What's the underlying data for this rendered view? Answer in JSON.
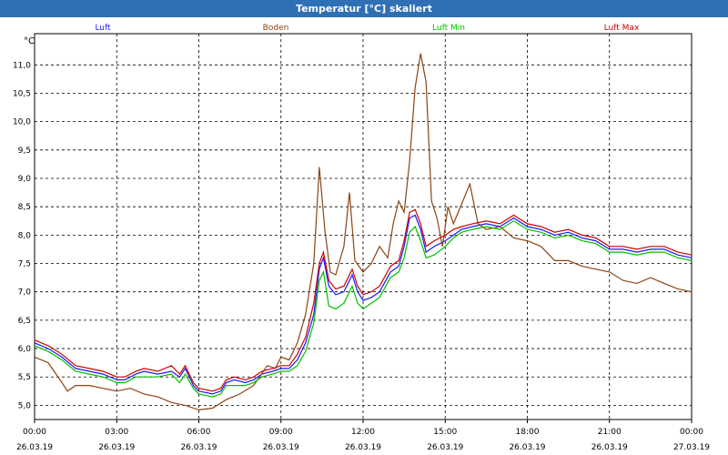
{
  "window": {
    "title": "Temperatur [°C] skaliert"
  },
  "chart_data": {
    "type": "line",
    "title": "Temperatur [°C] skaliert",
    "ylabel": "°C",
    "ylim": [
      4.75,
      11.55
    ],
    "yticks": [
      "5,0",
      "5,5",
      "6,0",
      "6,5",
      "7,0",
      "7,5",
      "8,0",
      "8,5",
      "9,0",
      "9,5",
      "10,0",
      "10,5",
      "11,0"
    ],
    "xlim_hours": [
      0,
      24
    ],
    "xticks": [
      {
        "time": "00:00",
        "date": "26.03.19"
      },
      {
        "time": "03:00",
        "date": "26.03.19"
      },
      {
        "time": "06:00",
        "date": "26.03.19"
      },
      {
        "time": "09:00",
        "date": "26.03.19"
      },
      {
        "time": "12:00",
        "date": "26.03.19"
      },
      {
        "time": "15:00",
        "date": "26.03.19"
      },
      {
        "time": "18:00",
        "date": "26.03.19"
      },
      {
        "time": "21:00",
        "date": "26.03.19"
      },
      {
        "time": "00:00",
        "date": "27.03.19"
      }
    ],
    "grid": true,
    "legend_position": "top",
    "series": [
      {
        "name": "Luft",
        "color": "#1a1aff",
        "points": [
          [
            0,
            6.1
          ],
          [
            0.5,
            6.0
          ],
          [
            1,
            5.85
          ],
          [
            1.5,
            5.65
          ],
          [
            2,
            5.6
          ],
          [
            2.5,
            5.55
          ],
          [
            3,
            5.45
          ],
          [
            3.3,
            5.45
          ],
          [
            3.7,
            5.55
          ],
          [
            4,
            5.6
          ],
          [
            4.5,
            5.55
          ],
          [
            5,
            5.6
          ],
          [
            5.3,
            5.5
          ],
          [
            5.5,
            5.65
          ],
          [
            5.8,
            5.35
          ],
          [
            6,
            5.25
          ],
          [
            6.5,
            5.2
          ],
          [
            6.8,
            5.25
          ],
          [
            7,
            5.4
          ],
          [
            7.3,
            5.45
          ],
          [
            7.7,
            5.4
          ],
          [
            8,
            5.45
          ],
          [
            8.3,
            5.55
          ],
          [
            8.7,
            5.6
          ],
          [
            9,
            5.65
          ],
          [
            9.3,
            5.65
          ],
          [
            9.6,
            5.8
          ],
          [
            9.9,
            6.1
          ],
          [
            10.2,
            6.6
          ],
          [
            10.4,
            7.4
          ],
          [
            10.55,
            7.6
          ],
          [
            10.75,
            7.1
          ],
          [
            11,
            6.95
          ],
          [
            11.3,
            7.0
          ],
          [
            11.6,
            7.3
          ],
          [
            11.8,
            7.0
          ],
          [
            12,
            6.85
          ],
          [
            12.3,
            6.9
          ],
          [
            12.6,
            7.0
          ],
          [
            13,
            7.35
          ],
          [
            13.3,
            7.45
          ],
          [
            13.5,
            7.8
          ],
          [
            13.7,
            8.3
          ],
          [
            13.9,
            8.35
          ],
          [
            14.1,
            8.1
          ],
          [
            14.3,
            7.7
          ],
          [
            14.6,
            7.8
          ],
          [
            15,
            7.9
          ],
          [
            15.3,
            8.0
          ],
          [
            15.6,
            8.1
          ],
          [
            16,
            8.15
          ],
          [
            16.5,
            8.2
          ],
          [
            17,
            8.15
          ],
          [
            17.5,
            8.3
          ],
          [
            18,
            8.15
          ],
          [
            18.5,
            8.1
          ],
          [
            19,
            8.0
          ],
          [
            19.5,
            8.05
          ],
          [
            20,
            7.95
          ],
          [
            20.5,
            7.9
          ],
          [
            21,
            7.75
          ],
          [
            21.5,
            7.75
          ],
          [
            22,
            7.7
          ],
          [
            22.5,
            7.75
          ],
          [
            23,
            7.75
          ],
          [
            23.5,
            7.65
          ],
          [
            24,
            7.6
          ]
        ]
      },
      {
        "name": "Boden",
        "color": "#8b4513",
        "points": [
          [
            0,
            5.85
          ],
          [
            0.5,
            5.75
          ],
          [
            1,
            5.4
          ],
          [
            1.2,
            5.25
          ],
          [
            1.5,
            5.35
          ],
          [
            2,
            5.35
          ],
          [
            2.5,
            5.3
          ],
          [
            3,
            5.25
          ],
          [
            3.5,
            5.3
          ],
          [
            4,
            5.2
          ],
          [
            4.5,
            5.15
          ],
          [
            5,
            5.05
          ],
          [
            5.5,
            5.0
          ],
          [
            6,
            4.92
          ],
          [
            6.5,
            4.95
          ],
          [
            7,
            5.1
          ],
          [
            7.5,
            5.2
          ],
          [
            8,
            5.35
          ],
          [
            8.5,
            5.7
          ],
          [
            8.8,
            5.65
          ],
          [
            9,
            5.85
          ],
          [
            9.3,
            5.8
          ],
          [
            9.6,
            6.1
          ],
          [
            9.9,
            6.6
          ],
          [
            10.2,
            7.5
          ],
          [
            10.4,
            9.2
          ],
          [
            10.6,
            8.1
          ],
          [
            10.8,
            7.35
          ],
          [
            11,
            7.3
          ],
          [
            11.3,
            7.8
          ],
          [
            11.5,
            8.75
          ],
          [
            11.7,
            7.55
          ],
          [
            12,
            7.35
          ],
          [
            12.3,
            7.5
          ],
          [
            12.6,
            7.8
          ],
          [
            12.9,
            7.6
          ],
          [
            13.1,
            8.2
          ],
          [
            13.3,
            8.6
          ],
          [
            13.5,
            8.4
          ],
          [
            13.7,
            9.3
          ],
          [
            13.9,
            10.6
          ],
          [
            14.1,
            11.2
          ],
          [
            14.3,
            10.7
          ],
          [
            14.5,
            8.6
          ],
          [
            14.7,
            8.3
          ],
          [
            14.9,
            7.8
          ],
          [
            15.1,
            8.5
          ],
          [
            15.3,
            8.2
          ],
          [
            15.6,
            8.55
          ],
          [
            15.9,
            8.9
          ],
          [
            16.2,
            8.2
          ],
          [
            16.5,
            8.1
          ],
          [
            17,
            8.15
          ],
          [
            17.5,
            7.95
          ],
          [
            18,
            7.9
          ],
          [
            18.5,
            7.8
          ],
          [
            19,
            7.55
          ],
          [
            19.5,
            7.55
          ],
          [
            20,
            7.45
          ],
          [
            20.5,
            7.4
          ],
          [
            21,
            7.35
          ],
          [
            21.5,
            7.2
          ],
          [
            22,
            7.15
          ],
          [
            22.5,
            7.25
          ],
          [
            23,
            7.15
          ],
          [
            23.5,
            7.05
          ],
          [
            24,
            7.0
          ]
        ]
      },
      {
        "name": "Luft Min",
        "color": "#00c000",
        "points": [
          [
            0,
            6.05
          ],
          [
            0.5,
            5.95
          ],
          [
            1,
            5.8
          ],
          [
            1.5,
            5.6
          ],
          [
            2,
            5.55
          ],
          [
            2.5,
            5.5
          ],
          [
            3,
            5.4
          ],
          [
            3.3,
            5.4
          ],
          [
            3.7,
            5.5
          ],
          [
            4,
            5.5
          ],
          [
            4.5,
            5.5
          ],
          [
            5,
            5.55
          ],
          [
            5.3,
            5.4
          ],
          [
            5.5,
            5.55
          ],
          [
            5.8,
            5.3
          ],
          [
            6,
            5.2
          ],
          [
            6.5,
            5.15
          ],
          [
            6.8,
            5.2
          ],
          [
            7,
            5.35
          ],
          [
            7.3,
            5.35
          ],
          [
            7.7,
            5.35
          ],
          [
            8,
            5.4
          ],
          [
            8.3,
            5.5
          ],
          [
            8.7,
            5.55
          ],
          [
            9,
            5.6
          ],
          [
            9.3,
            5.6
          ],
          [
            9.6,
            5.7
          ],
          [
            9.9,
            5.95
          ],
          [
            10.2,
            6.45
          ],
          [
            10.4,
            7.2
          ],
          [
            10.55,
            7.35
          ],
          [
            10.75,
            6.75
          ],
          [
            11,
            6.7
          ],
          [
            11.3,
            6.8
          ],
          [
            11.6,
            7.1
          ],
          [
            11.8,
            6.8
          ],
          [
            12,
            6.7
          ],
          [
            12.3,
            6.8
          ],
          [
            12.6,
            6.9
          ],
          [
            13,
            7.25
          ],
          [
            13.3,
            7.35
          ],
          [
            13.5,
            7.6
          ],
          [
            13.7,
            8.05
          ],
          [
            13.9,
            8.15
          ],
          [
            14.1,
            7.9
          ],
          [
            14.3,
            7.6
          ],
          [
            14.6,
            7.65
          ],
          [
            15,
            7.8
          ],
          [
            15.3,
            7.95
          ],
          [
            15.6,
            8.05
          ],
          [
            16,
            8.1
          ],
          [
            16.5,
            8.15
          ],
          [
            17,
            8.1
          ],
          [
            17.5,
            8.25
          ],
          [
            18,
            8.1
          ],
          [
            18.5,
            8.05
          ],
          [
            19,
            7.95
          ],
          [
            19.5,
            8.0
          ],
          [
            20,
            7.9
          ],
          [
            20.5,
            7.85
          ],
          [
            21,
            7.7
          ],
          [
            21.5,
            7.7
          ],
          [
            22,
            7.65
          ],
          [
            22.5,
            7.7
          ],
          [
            23,
            7.7
          ],
          [
            23.5,
            7.6
          ],
          [
            24,
            7.55
          ]
        ]
      },
      {
        "name": "Luft Max",
        "color": "#cc0000",
        "points": [
          [
            0,
            6.15
          ],
          [
            0.5,
            6.05
          ],
          [
            1,
            5.9
          ],
          [
            1.5,
            5.7
          ],
          [
            2,
            5.65
          ],
          [
            2.5,
            5.6
          ],
          [
            3,
            5.5
          ],
          [
            3.3,
            5.5
          ],
          [
            3.7,
            5.6
          ],
          [
            4,
            5.65
          ],
          [
            4.5,
            5.6
          ],
          [
            5,
            5.7
          ],
          [
            5.3,
            5.55
          ],
          [
            5.5,
            5.7
          ],
          [
            5.8,
            5.4
          ],
          [
            6,
            5.3
          ],
          [
            6.5,
            5.25
          ],
          [
            6.8,
            5.3
          ],
          [
            7,
            5.45
          ],
          [
            7.3,
            5.5
          ],
          [
            7.7,
            5.45
          ],
          [
            8,
            5.5
          ],
          [
            8.3,
            5.6
          ],
          [
            8.7,
            5.65
          ],
          [
            9,
            5.7
          ],
          [
            9.3,
            5.7
          ],
          [
            9.6,
            5.9
          ],
          [
            9.9,
            6.2
          ],
          [
            10.2,
            6.8
          ],
          [
            10.4,
            7.5
          ],
          [
            10.55,
            7.7
          ],
          [
            10.75,
            7.2
          ],
          [
            11,
            7.05
          ],
          [
            11.3,
            7.1
          ],
          [
            11.6,
            7.4
          ],
          [
            11.8,
            7.1
          ],
          [
            12,
            6.95
          ],
          [
            12.3,
            7.0
          ],
          [
            12.6,
            7.1
          ],
          [
            13,
            7.45
          ],
          [
            13.3,
            7.55
          ],
          [
            13.5,
            7.9
          ],
          [
            13.7,
            8.4
          ],
          [
            13.9,
            8.45
          ],
          [
            14.1,
            8.2
          ],
          [
            14.3,
            7.8
          ],
          [
            14.6,
            7.9
          ],
          [
            15,
            8.0
          ],
          [
            15.3,
            8.1
          ],
          [
            15.6,
            8.15
          ],
          [
            16,
            8.2
          ],
          [
            16.5,
            8.25
          ],
          [
            17,
            8.2
          ],
          [
            17.5,
            8.35
          ],
          [
            18,
            8.2
          ],
          [
            18.5,
            8.15
          ],
          [
            19,
            8.05
          ],
          [
            19.5,
            8.1
          ],
          [
            20,
            8.0
          ],
          [
            20.5,
            7.95
          ],
          [
            21,
            7.8
          ],
          [
            21.5,
            7.8
          ],
          [
            22,
            7.75
          ],
          [
            22.5,
            7.8
          ],
          [
            23,
            7.8
          ],
          [
            23.5,
            7.7
          ],
          [
            24,
            7.65
          ]
        ]
      }
    ]
  }
}
